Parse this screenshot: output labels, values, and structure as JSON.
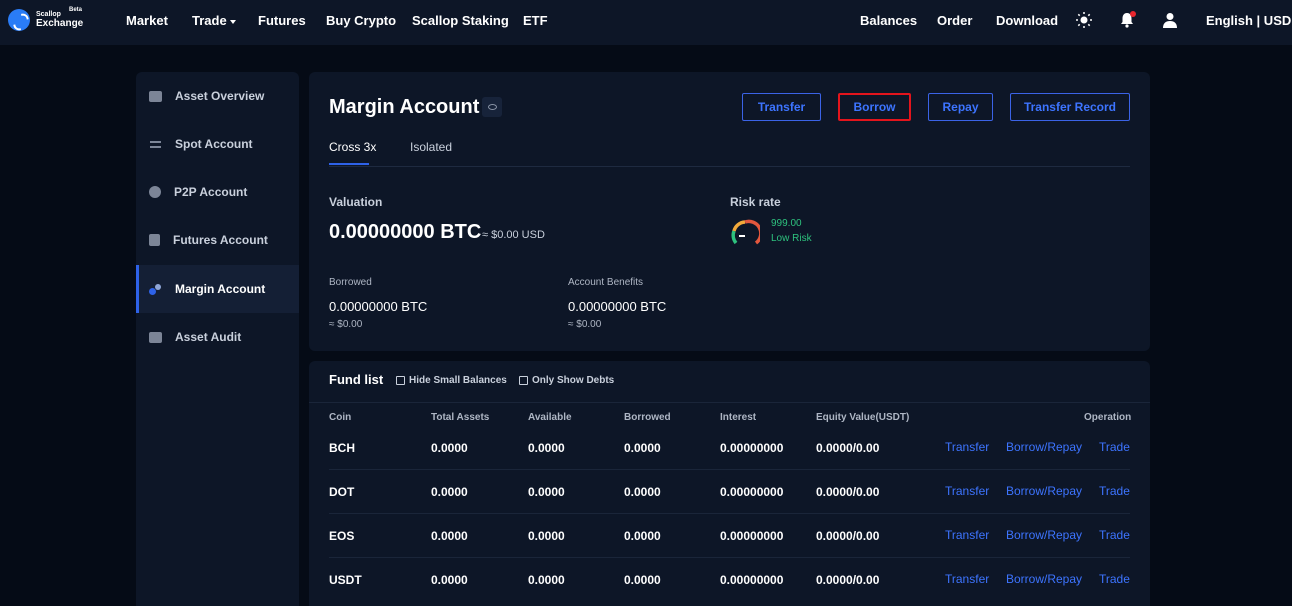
{
  "brand": {
    "name_small": "Scallop",
    "name_big": "Exchange",
    "badge": "Beta"
  },
  "nav": {
    "market": "Market",
    "trade": "Trade",
    "futures": "Futures",
    "buy_crypto": "Buy Crypto",
    "staking": "Scallop Staking",
    "etf": "ETF",
    "balances": "Balances",
    "order": "Order",
    "download": "Download",
    "language": "English | USD"
  },
  "sidebar": {
    "items": [
      {
        "label": "Asset Overview",
        "icon": "wallet-icon"
      },
      {
        "label": "Spot Account",
        "icon": "swap-icon"
      },
      {
        "label": "P2P Account",
        "icon": "p2p-icon"
      },
      {
        "label": "Futures Account",
        "icon": "futures-icon"
      },
      {
        "label": "Margin Account",
        "icon": "margin-icon",
        "active": true
      },
      {
        "label": "Asset Audit",
        "icon": "audit-icon"
      }
    ]
  },
  "header": {
    "title": "Margin Account",
    "buttons": {
      "transfer": "Transfer",
      "borrow": "Borrow",
      "repay": "Repay",
      "transfer_record": "Transfer Record"
    },
    "tabs": {
      "cross": "Cross 3x",
      "isolated": "Isolated"
    }
  },
  "summary": {
    "valuation_label": "Valuation",
    "valuation_value": "0.00000000 BTC",
    "valuation_usd": "≈ $0.00 USD",
    "risk_label": "Risk rate",
    "risk_value": "999.00",
    "risk_status": "Low Risk",
    "borrowed_label": "Borrowed",
    "borrowed_value": "0.00000000 BTC",
    "borrowed_usd": "≈ $0.00",
    "benefits_label": "Account Benefits",
    "benefits_value": "0.00000000 BTC",
    "benefits_usd": "≈ $0.00"
  },
  "fund_list": {
    "title": "Fund list",
    "hide_small": "Hide Small Balances",
    "only_debts": "Only Show Debts",
    "columns": [
      "Coin",
      "Total Assets",
      "Available",
      "Borrowed",
      "Interest",
      "Equity Value(USDT)",
      "Operation"
    ],
    "rows": [
      {
        "coin": "BCH",
        "total": "0.0000",
        "available": "0.0000",
        "borrowed": "0.0000",
        "interest": "0.00000000",
        "equity": "0.0000/0.00"
      },
      {
        "coin": "DOT",
        "total": "0.0000",
        "available": "0.0000",
        "borrowed": "0.0000",
        "interest": "0.00000000",
        "equity": "0.0000/0.00"
      },
      {
        "coin": "EOS",
        "total": "0.0000",
        "available": "0.0000",
        "borrowed": "0.0000",
        "interest": "0.00000000",
        "equity": "0.0000/0.00"
      },
      {
        "coin": "USDT",
        "total": "0.0000",
        "available": "0.0000",
        "borrowed": "0.0000",
        "interest": "0.00000000",
        "equity": "0.0000/0.00"
      }
    ],
    "ops": {
      "transfer": "Transfer",
      "borrow_repay": "Borrow/Repay",
      "trade": "Trade"
    }
  },
  "colors": {
    "accent": "#3d74ff",
    "highlight": "#e3141c",
    "risk_good": "#2ec27e"
  }
}
